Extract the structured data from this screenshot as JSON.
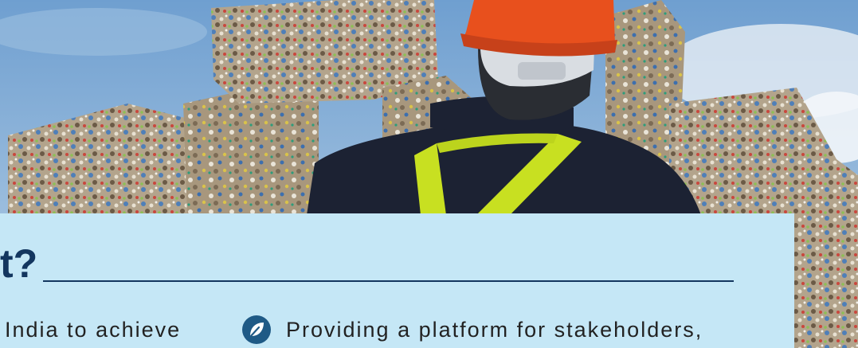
{
  "heading": {
    "fragment": "t?"
  },
  "columns": {
    "left_text": "India to achieve",
    "right_item": {
      "icon": "leaf-icon",
      "text": "Providing a platform for stakeholders,"
    }
  },
  "colors": {
    "panel_bg": "#c5e7f6",
    "heading": "#13365f",
    "hardhat": "#e8501d",
    "vest_stripe": "#c8e021"
  }
}
